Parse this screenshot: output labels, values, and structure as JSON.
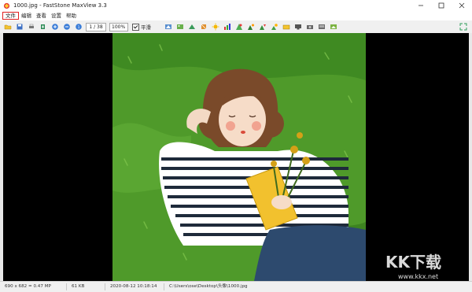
{
  "window": {
    "title": "1000.jpg - FastStone MaxView 3.3",
    "controls": [
      "minimize",
      "maximize",
      "close"
    ]
  },
  "menu": {
    "items": [
      {
        "label": "文件",
        "highlighted": true
      },
      {
        "label": "编辑"
      },
      {
        "label": "查看"
      },
      {
        "label": "设置"
      },
      {
        "label": "帮助"
      }
    ]
  },
  "toolbar": {
    "page_indicator": "1 / 38",
    "zoom": "100%",
    "fit_option": "平滑",
    "fit_checked": true,
    "icons": [
      "open-folder-icon",
      "save-icon",
      "print-icon",
      "copy-icon",
      "zoom-in-icon",
      "zoom-out-icon",
      "actual-size-icon",
      "rotate-left-icon",
      "rotate-right-icon",
      "flip-icon",
      "crop-icon",
      "resize-icon",
      "color-adjust-icon",
      "sharpen-icon",
      "brightness-icon",
      "effects-icon",
      "red-eye-icon",
      "slideshow-icon",
      "wallpaper-icon",
      "email-icon",
      "settings-icon",
      "info-icon",
      "fullscreen-icon"
    ]
  },
  "status": {
    "dimensions": "690 x 682 = 0.47 MP",
    "file_size": "61 KB",
    "datetime": "2020-08-12 10:18:14",
    "path": "C:\\Users\\ose\\Desktop\\头像\\1000.jpg"
  },
  "watermark": {
    "text": "KK下载",
    "url": "www.kkx.net"
  },
  "colors": {
    "accent_red": "#e02020",
    "grass": "#4f9a2a",
    "viewer_bg": "#000000"
  }
}
